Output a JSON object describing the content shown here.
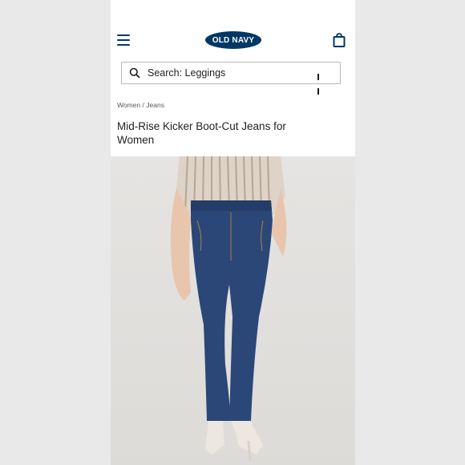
{
  "header": {
    "menu_icon": "hamburger-menu-icon",
    "logo_text": "OLD NAVY",
    "bag_icon": "shopping-bag-icon",
    "brand_color": "#003764"
  },
  "search": {
    "icon": "search-icon",
    "text": "Search: Leggings",
    "control_icon": "pause-icon"
  },
  "breadcrumb": {
    "items": [
      "Women",
      "Jeans"
    ],
    "separator": "/"
  },
  "product": {
    "title": "Mid-Rise Kicker Boot-Cut Jeans for Women",
    "image_description": "model wearing dark blue boot-cut jeans, striped shirt, white heeled sandals"
  }
}
